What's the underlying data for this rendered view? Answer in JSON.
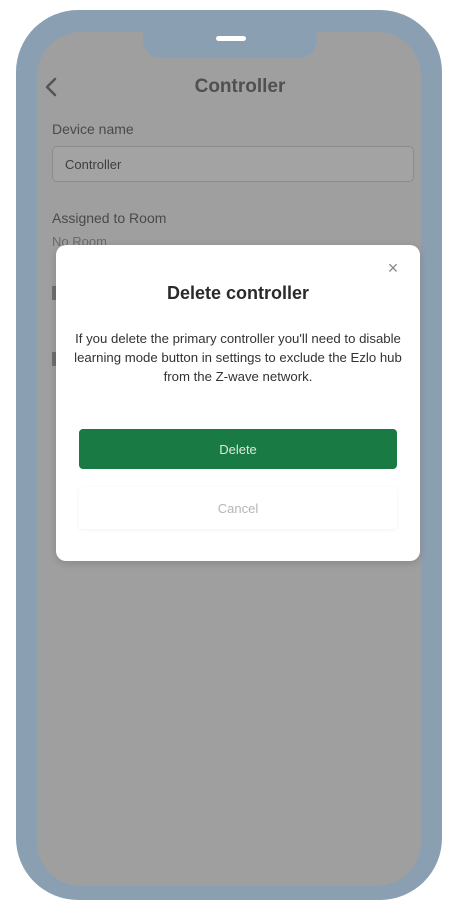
{
  "screen": {
    "title": "Controller",
    "device_name_label": "Device name",
    "device_name_value": "Controller",
    "assigned_room_label": "Assigned to Room",
    "assigned_room_value": "No Room"
  },
  "modal": {
    "title": "Delete controller",
    "message": "If you delete the primary controller you'll need to disable learning mode button in settings to exclude the Ezlo hub from the Z-wave network.",
    "delete_label": "Delete",
    "cancel_label": "Cancel",
    "close_glyph": "×"
  },
  "icons": {
    "back": "chevron-left-icon",
    "close": "close-icon"
  },
  "colors": {
    "frame": "#8a9fb2",
    "overlay_screen": "#9f9f9f",
    "delete_button": "#1a7a43",
    "modal_background": "#ffffff"
  }
}
